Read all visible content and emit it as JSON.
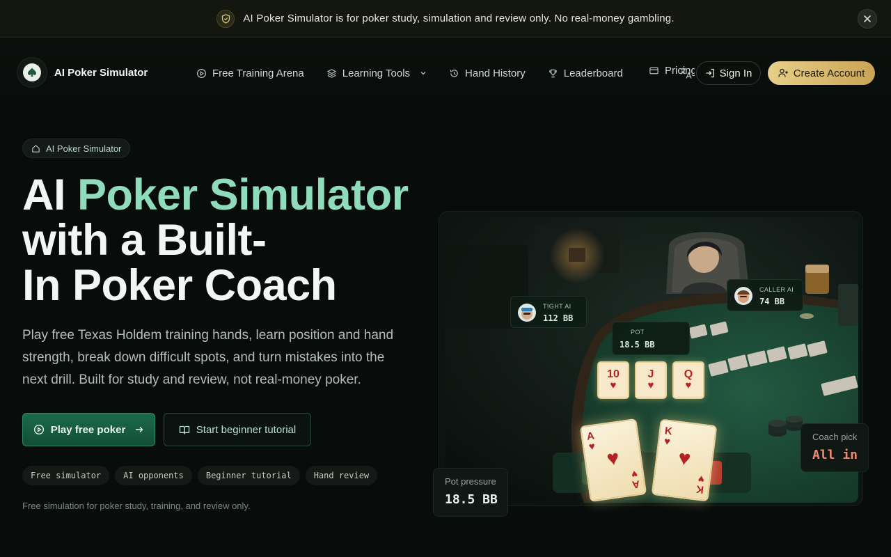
{
  "banner": {
    "icon": "shield-icon",
    "text": "AI Poker Simulator is for poker study, simulation and review only. No real-money gambling.",
    "close_icon": "close-icon"
  },
  "nav": {
    "brand": "AI Poker Simulator",
    "links": [
      {
        "label": "Free Training Arena",
        "icon": "play-circle-icon"
      },
      {
        "label": "Learning Tools",
        "icon": "layers-icon",
        "has_dropdown": true
      },
      {
        "label": "Hand History",
        "icon": "history-icon"
      },
      {
        "label": "Leaderboard",
        "icon": "trophy-icon"
      },
      {
        "label": "Pricing",
        "icon": "card-icon"
      }
    ],
    "sign_in": "Sign In",
    "create_account": "Create Account"
  },
  "hero": {
    "badge": "AI Poker Simulator",
    "title_line1_plain": "AI ",
    "title_line1_accent": "Poker Simulator",
    "title_line2": "with a Built-",
    "title_line3": "In Poker Coach",
    "description": "Play free Texas Holdem training hands, learn position and hand strength, break down difficult spots, and turn mistakes into the next drill. Built for study and review, not real-money poker.",
    "primary_button": "Play free poker",
    "secondary_button": "Start beginner tutorial",
    "chips": [
      "Free simulator",
      "AI opponents",
      "Beginner tutorial",
      "Hand review"
    ],
    "footnote": "Free simulation for poker study, training, and review only."
  },
  "table": {
    "tight_ai": {
      "label": "TIGHT AI",
      "stack": "112 BB"
    },
    "caller_ai": {
      "label": "CALLER AI",
      "stack": "74 BB"
    },
    "pot": {
      "label": "POT",
      "amount": "18.5 BB"
    },
    "board": [
      {
        "rank": "10",
        "suit": "♥"
      },
      {
        "rank": "J",
        "suit": "♥"
      },
      {
        "rank": "Q",
        "suit": "♥"
      }
    ],
    "hole": [
      {
        "rank": "A",
        "suit": "♥"
      },
      {
        "rank": "K",
        "suit": "♥"
      }
    ],
    "coach": {
      "label": "Coach pick",
      "value": "All in"
    },
    "pot_pressure": {
      "label": "Pot pressure",
      "value": "18.5 BB"
    }
  },
  "colors": {
    "accent": "#8fdcbc",
    "gold": "#e8cf8a",
    "felt": "#1d4a37",
    "hearts": "#b32323",
    "coach_value": "#f08a6e"
  }
}
